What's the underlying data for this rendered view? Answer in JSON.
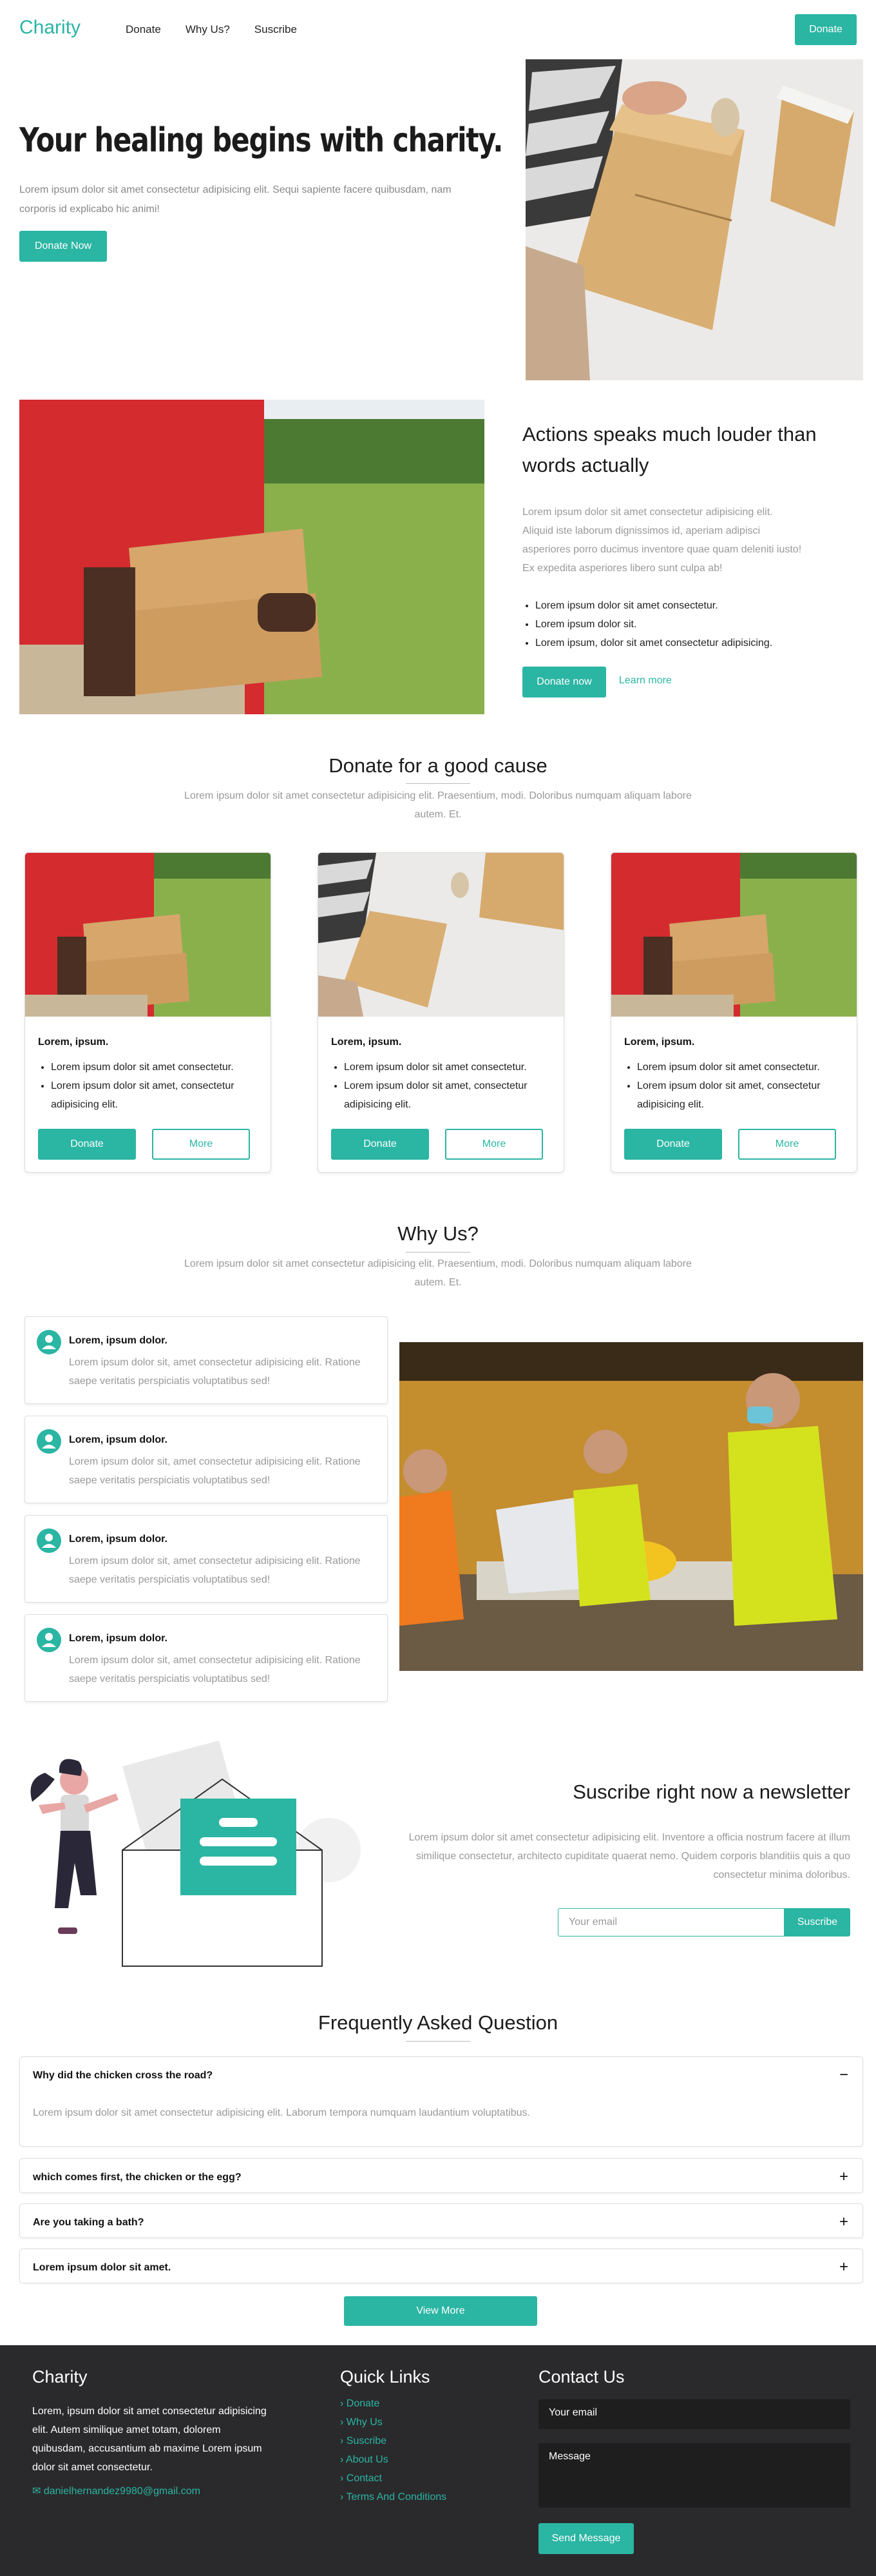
{
  "nav": {
    "brand": "Charity",
    "links": [
      "Donate",
      "Why Us?",
      "Suscribe"
    ],
    "donate_button": "Donate"
  },
  "hero": {
    "title": "Your healing begins with charity.",
    "text": "Lorem ipsum dolor sit amet consectetur adipisicing elit. Sequi sapiente facere quibusdam, nam corporis id explicabo hic animi!",
    "button": "Donate Now"
  },
  "actions": {
    "title": "Actions speaks much louder than words actually",
    "text": "Lorem ipsum dolor sit amet consectetur adipisicing elit. Aliquid iste laborum dignissimos id, aperiam adipisci asperiores porro ducimus inventore quae quam deleniti iusto! Ex expedita asperiores libero sunt culpa ab!",
    "list": [
      "Lorem ipsum dolor sit amet consectetur.",
      "Lorem ipsum dolor sit.",
      "Lorem ipsum, dolor sit amet consectetur adipisicing."
    ],
    "button": "Donate now",
    "link": "Learn more"
  },
  "donate_section": {
    "title": "Donate for a good cause",
    "subtitle": "Lorem ipsum dolor sit amet consectetur adipisicing elit. Praesentium, modi. Doloribus numquam aliquam labore autem. Et.",
    "cards": [
      {
        "title": "Lorem, ipsum.",
        "items": [
          "Lorem ipsum dolor sit amet consectetur.",
          "Lorem ipsum dolor sit amet, consectetur adipisicing elit."
        ],
        "donate": "Donate",
        "more": "More"
      },
      {
        "title": "Lorem, ipsum.",
        "items": [
          "Lorem ipsum dolor sit amet consectetur.",
          "Lorem ipsum dolor sit amet, consectetur adipisicing elit."
        ],
        "donate": "Donate",
        "more": "More"
      },
      {
        "title": "Lorem, ipsum.",
        "items": [
          "Lorem ipsum dolor sit amet consectetur.",
          "Lorem ipsum dolor sit amet, consectetur adipisicing elit."
        ],
        "donate": "Donate",
        "more": "More"
      }
    ]
  },
  "why": {
    "title": "Why Us?",
    "subtitle": "Lorem ipsum dolor sit amet consectetur adipisicing elit. Praesentium, modi. Doloribus numquam aliquam labore autem. Et.",
    "items": [
      {
        "title": "Lorem, ipsum dolor.",
        "text": "Lorem ipsum dolor sit, amet consectetur adipisicing elit. Ratione saepe veritatis perspiciatis voluptatibus sed!"
      },
      {
        "title": "Lorem, ipsum dolor.",
        "text": "Lorem ipsum dolor sit, amet consectetur adipisicing elit. Ratione saepe veritatis perspiciatis voluptatibus sed!"
      },
      {
        "title": "Lorem, ipsum dolor.",
        "text": "Lorem ipsum dolor sit, amet consectetur adipisicing elit. Ratione saepe veritatis perspiciatis voluptatibus sed!"
      },
      {
        "title": "Lorem, ipsum dolor.",
        "text": "Lorem ipsum dolor sit, amet consectetur adipisicing elit. Ratione saepe veritatis perspiciatis voluptatibus sed!"
      }
    ]
  },
  "newsletter": {
    "title": "Suscribe right now a newsletter",
    "text": "Lorem ipsum dolor sit amet consectetur adipisicing elit. Inventore a officia nostrum facere at illum similique consectetur, architecto cupiditate quaerat nemo. Quidem corporis blanditiis quis a quo consectetur minima doloribus.",
    "placeholder": "Your email",
    "button": "Suscribe"
  },
  "faq": {
    "title": "Frequently Asked Question",
    "items": [
      {
        "q": "Why did the chicken cross the road?",
        "a": "Lorem ipsum dolor sit amet consectetur adipisicing elit. Laborum tempora numquam laudantium voluptatibus.",
        "toggle": "−"
      },
      {
        "q": "which comes first, the chicken or the egg?",
        "toggle": "+"
      },
      {
        "q": "Are you taking a bath?",
        "toggle": "+"
      },
      {
        "q": "Lorem ipsum dolor sit amet.",
        "toggle": "+"
      }
    ],
    "more_button": "View More"
  },
  "footer": {
    "brand": "Charity",
    "text": "Lorem, ipsum dolor sit amet consectetur adipisicing elit. Autem similique amet totam, dolorem quibusdam, accusantium ab maxime Lorem ipsum dolor sit amet consectetur.",
    "email": "danielhernandez9980@gmail.com",
    "quick_links_title": "Quick Links",
    "quick_links": [
      "Donate",
      "Why Us",
      "Suscribe",
      "About Us",
      "Contact",
      "Terms And Conditions"
    ],
    "contact_title": "Contact Us",
    "email_placeholder": "Your email",
    "message_placeholder": "Message",
    "send_button": "Send Message"
  },
  "colors": {
    "accent": "#2bb5a3",
    "footer_bg": "#2a2a2c"
  }
}
